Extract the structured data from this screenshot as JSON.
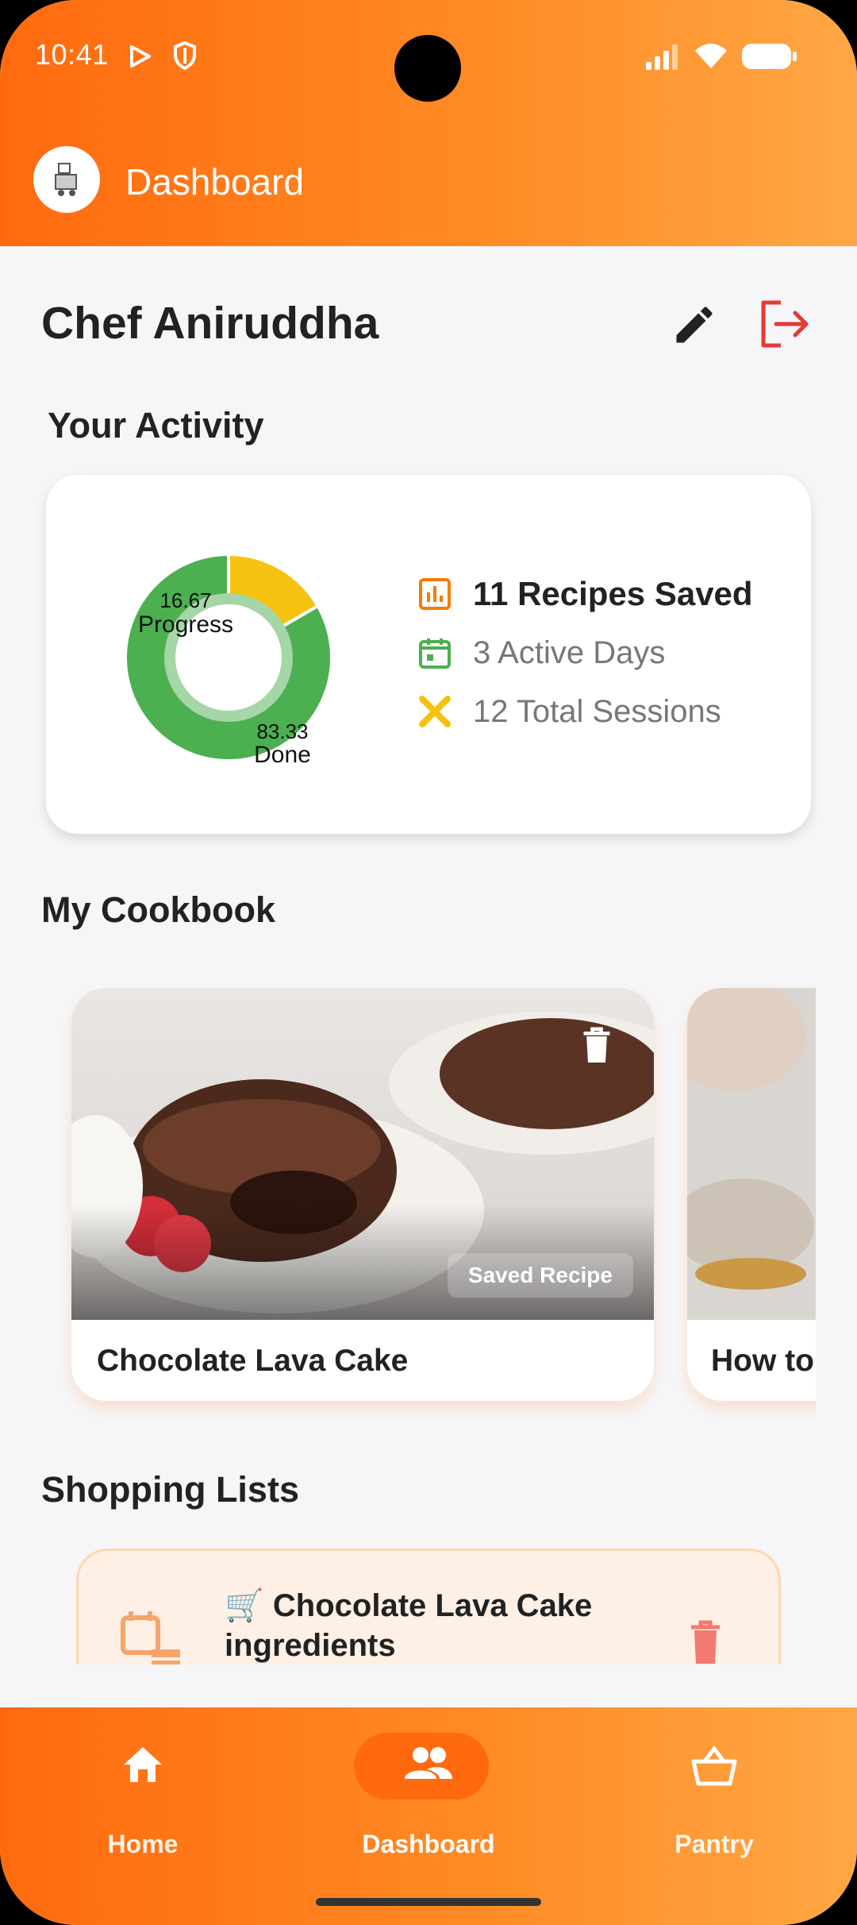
{
  "status_bar": {
    "time": "10:41"
  },
  "app_bar": {
    "title": "Dashboard"
  },
  "profile": {
    "name": "Chef Aniruddha"
  },
  "activity": {
    "section_title": "Your Activity",
    "chart_data": {
      "type": "pie",
      "slices": [
        {
          "label": "Progress",
          "value": 16.67,
          "color": "#f5c20f"
        },
        {
          "label": "Done",
          "value": 83.33,
          "color": "#4caf50"
        }
      ],
      "value_labels": [
        "16.67",
        "83.33"
      ]
    },
    "stats": [
      {
        "icon": "chart-icon",
        "text": "11 Recipes Saved",
        "color": "#f57c00"
      },
      {
        "icon": "calendar-icon",
        "text": "3 Active Days",
        "color": "#4caf50"
      },
      {
        "icon": "utensils-icon",
        "text": "12 Total Sessions",
        "color": "#f5c20f"
      }
    ]
  },
  "cookbook": {
    "section_title": "My Cookbook",
    "recipes": [
      {
        "title": "Chocolate Lava Cake",
        "badge": "Saved Recipe"
      },
      {
        "title": "How to",
        "badge": ""
      }
    ]
  },
  "shopping": {
    "section_title": "Shopping Lists",
    "lists": [
      {
        "title": "🛒 Chocolate Lava Cake ingredients"
      }
    ]
  },
  "bottom_nav": {
    "items": [
      {
        "label": "Home",
        "icon": "home-icon",
        "active": false
      },
      {
        "label": "Dashboard",
        "icon": "people-icon",
        "active": true
      },
      {
        "label": "Pantry",
        "icon": "basket-icon",
        "active": false
      }
    ]
  }
}
